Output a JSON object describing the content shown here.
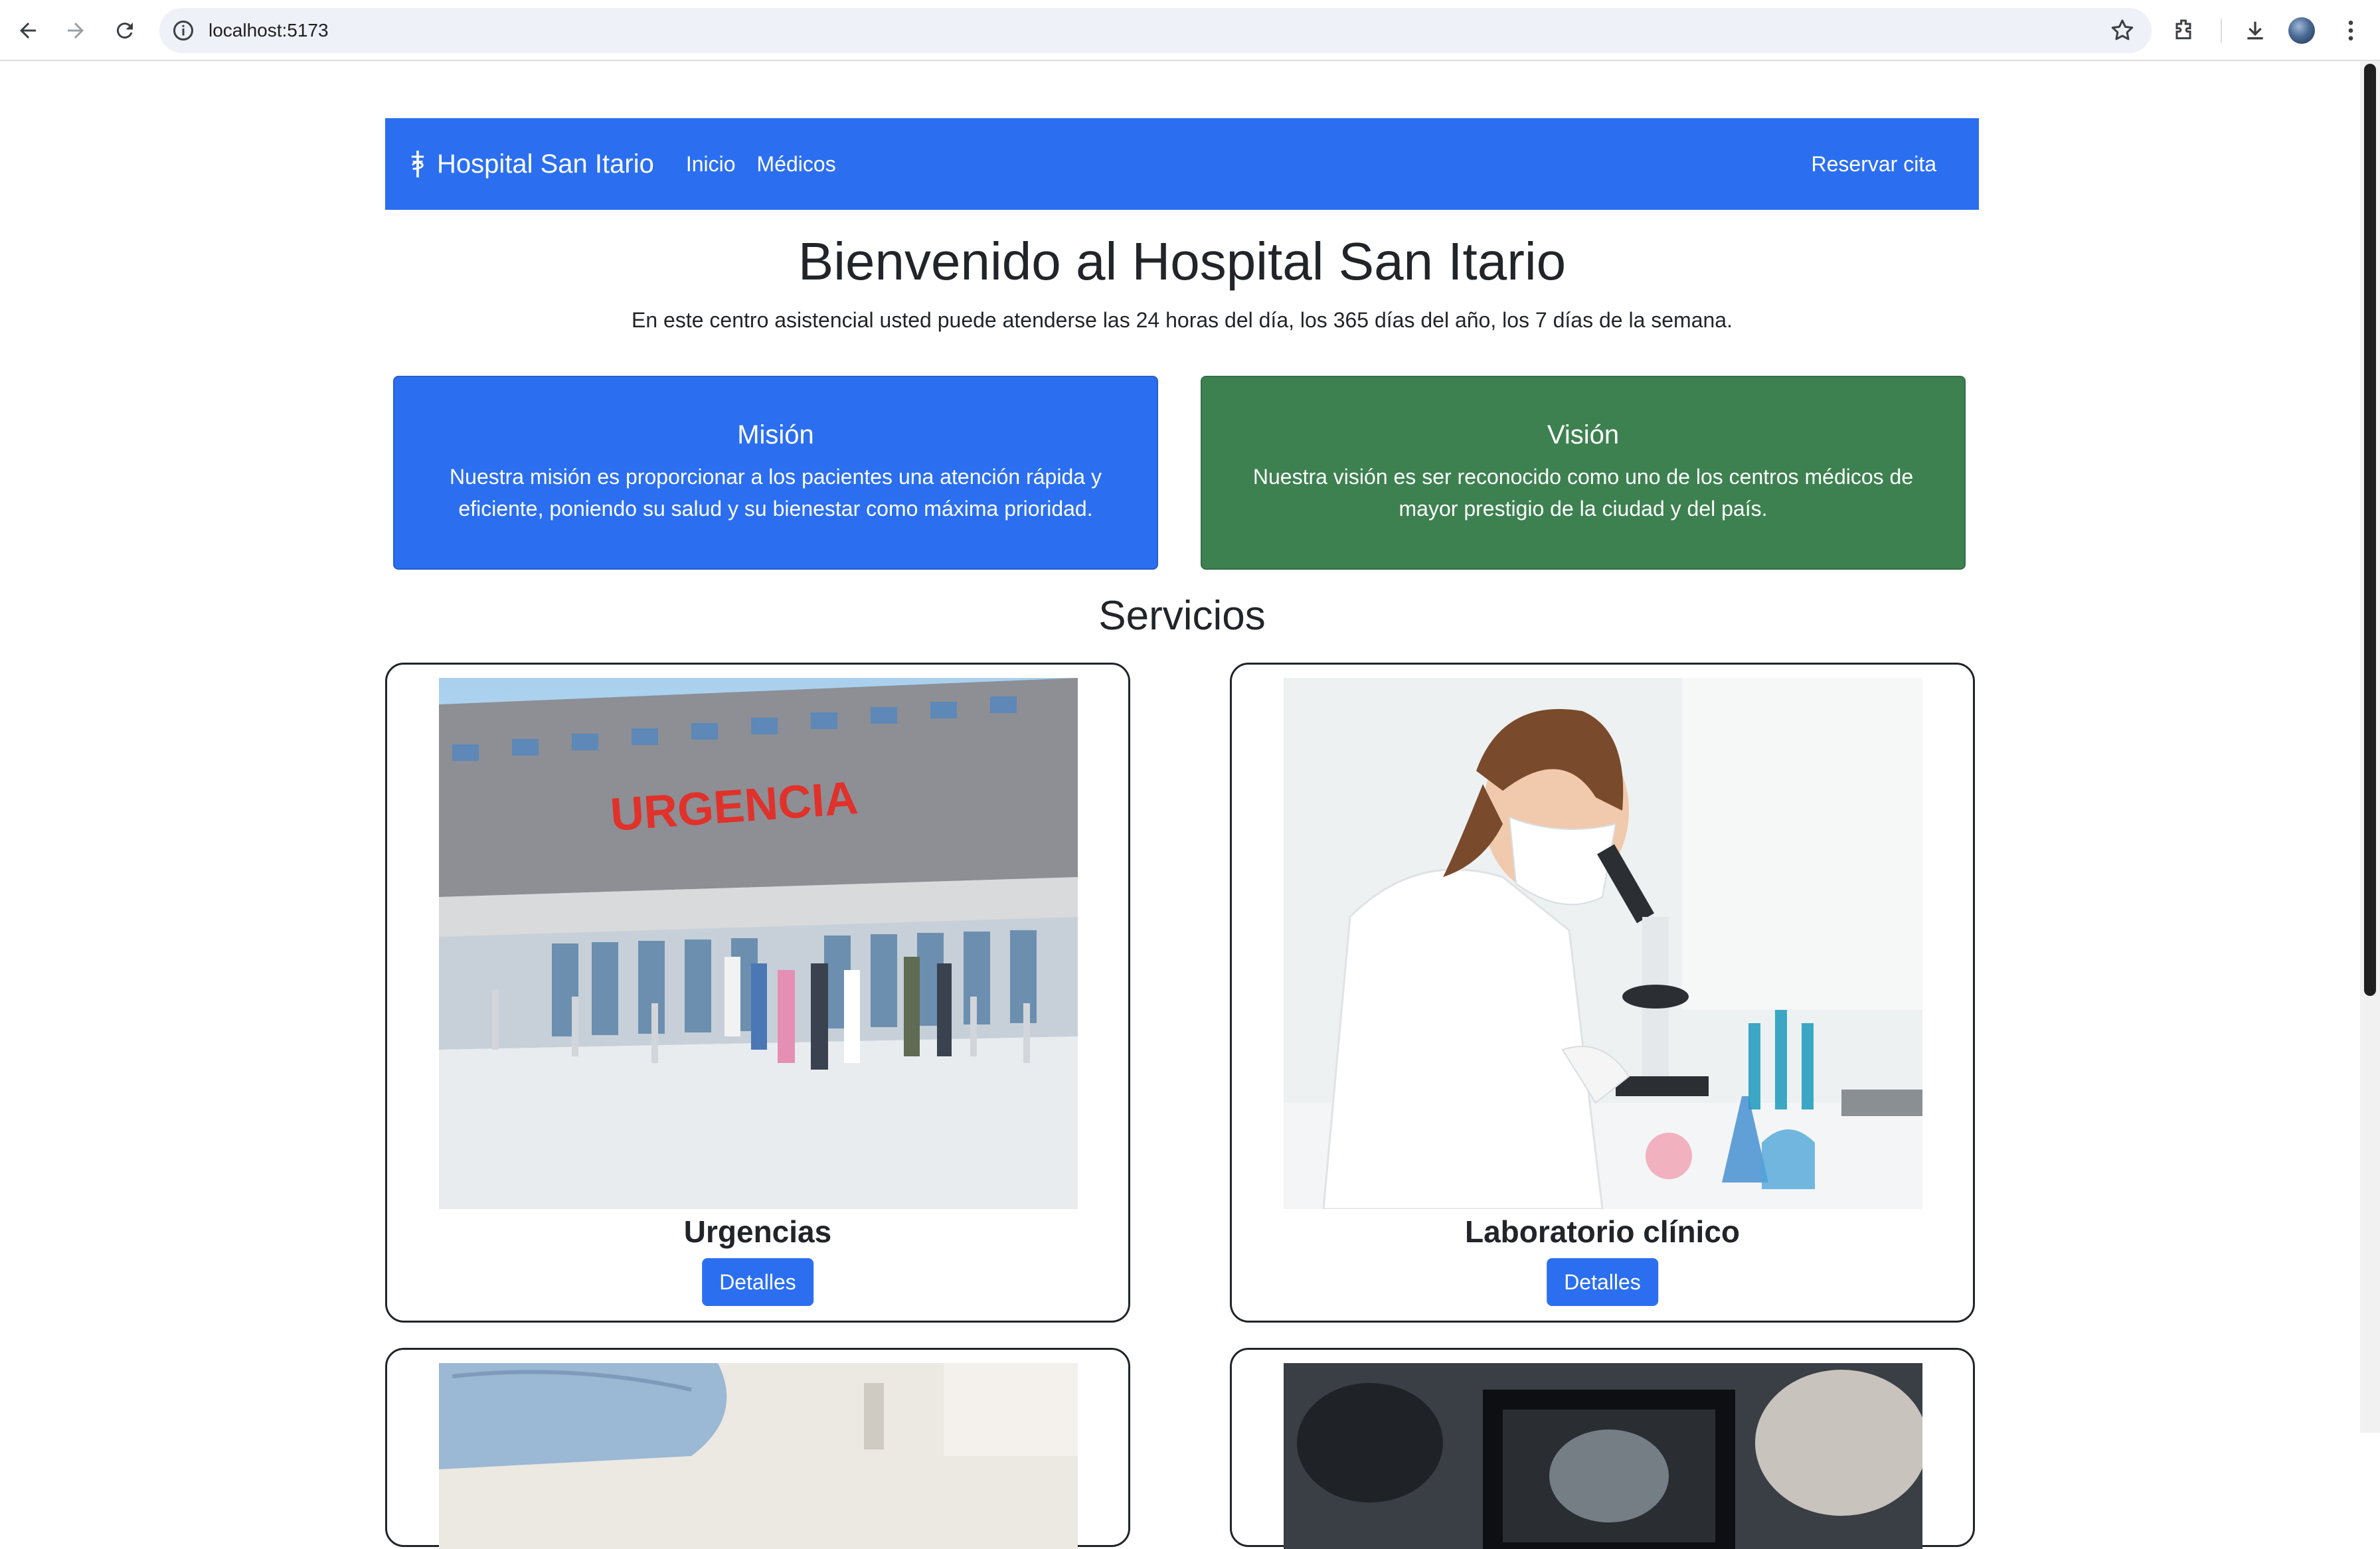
{
  "browser": {
    "url": "localhost:5173"
  },
  "navbar": {
    "brand": "Hospital San Itario",
    "links": [
      "Inicio",
      "Médicos"
    ],
    "cta": "Reservar cita",
    "color": "#2b6ff0"
  },
  "hero": {
    "title": "Bienvenido al Hospital San Itario",
    "subtitle": "En este centro asistencial usted puede atenderse las 24 horas del día, los 365 días del año, los 7 días de la semana."
  },
  "mission": {
    "title": "Misión",
    "text": "Nuestra misión es proporcionar a los pacientes una atención rápida y eficiente, poniendo su salud y su bienestar como máxima prioridad.",
    "color": "#2b6ff0"
  },
  "vision": {
    "title": "Visión",
    "text": "Nuestra visión es ser reconocido como uno de los centros médicos de mayor prestigio de la ciudad y del país.",
    "color": "#3d8150"
  },
  "services": {
    "title": "Servicios",
    "items": [
      {
        "name": "Urgencias",
        "button": "Detalles",
        "image_sign": "URGENCIA"
      },
      {
        "name": "Laboratorio clínico",
        "button": "Detalles"
      },
      {
        "name": "",
        "button": ""
      },
      {
        "name": "",
        "button": ""
      }
    ]
  }
}
